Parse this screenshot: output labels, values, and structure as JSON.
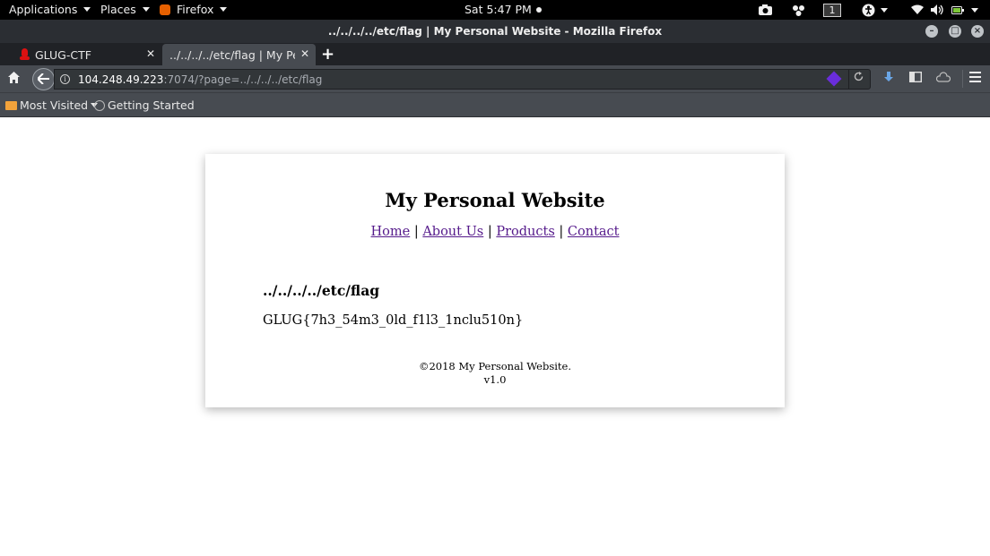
{
  "topbar": {
    "applications_label": "Applications",
    "places_label": "Places",
    "firefox_label": "Firefox",
    "clock": "Sat  5:47 PM",
    "workspace": "1"
  },
  "window": {
    "title": "../../../../etc/flag | My Personal Website - Mozilla Firefox"
  },
  "tabs": [
    {
      "label": "GLUG-CTF",
      "active": false
    },
    {
      "label": "../../../../etc/flag | My Per...",
      "active": true
    }
  ],
  "urlbar": {
    "host": "104.248.49.223",
    "rest": ":7074/?page=../../../../etc/flag"
  },
  "bookmarks": {
    "most_visited": "Most Visited",
    "getting_started": "Getting Started"
  },
  "page": {
    "site_title": "My Personal Website",
    "nav": [
      {
        "label": "Home"
      },
      {
        "label": "About Us"
      },
      {
        "label": "Products"
      },
      {
        "label": "Contact"
      }
    ],
    "nav_separator": "|",
    "heading": "../../../../etc/flag",
    "body_text": "GLUG{7h3_54m3_0ld_f1l3_1nclu510n}",
    "footer_line1": "©2018 My Personal Website.",
    "footer_line2": "v1.0"
  },
  "colors": {
    "link_visited": "#551a8b",
    "toolbar": "#474b51",
    "topbar": "#000000"
  }
}
